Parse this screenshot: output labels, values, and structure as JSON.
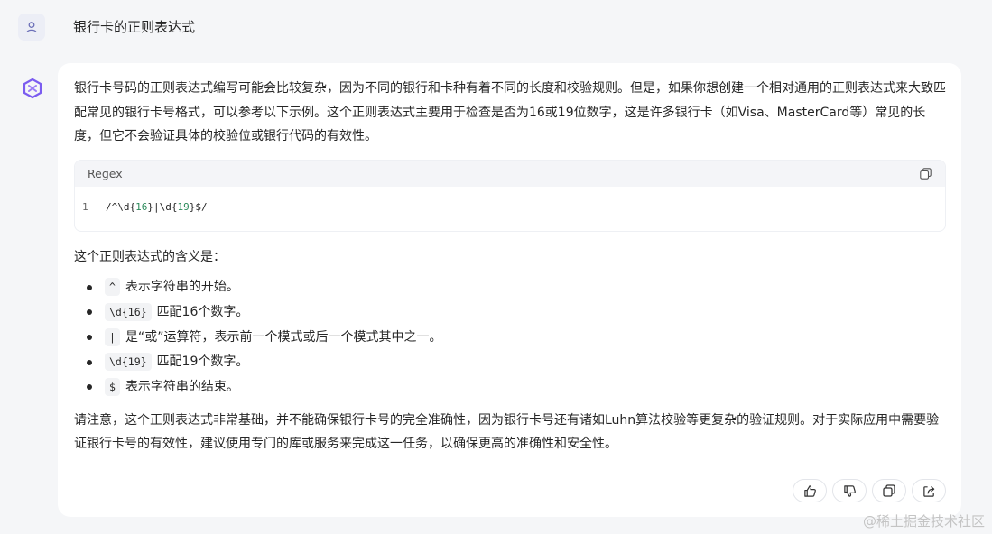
{
  "user": {
    "message": "银行卡的正则表达式"
  },
  "answer": {
    "intro": "银行卡号码的正则表达式编写可能会比较复杂，因为不同的银行和卡种有着不同的长度和校验规则。但是，如果你想创建一个相对通用的正则表达式来大致匹配常见的银行卡号格式，可以参考以下示例。这个正则表达式主要用于检查是否为16或19位数字，这是许多银行卡（如Visa、MasterCard等）常见的长度，但它不会验证具体的校验位或银行代码的有效性。",
    "code": {
      "language": "Regex",
      "line_number": "1",
      "parts": [
        "/^\\d{",
        "16",
        "}|\\d{",
        "19",
        "}$/"
      ]
    },
    "meaning_heading": "这个正则表达式的含义是：",
    "bullets": [
      {
        "token": "^",
        "text": "表示字符串的开始。"
      },
      {
        "token": "\\d{16}",
        "text": "匹配16个数字。"
      },
      {
        "token": "|",
        "text": "是“或”运算符，表示前一个模式或后一个模式其中之一。"
      },
      {
        "token": "\\d{19}",
        "text": "匹配19个数字。"
      },
      {
        "token": "$",
        "text": "表示字符串的结束。"
      }
    ],
    "note": "请注意，这个正则表达式非常基础，并不能确保银行卡号的完全准确性，因为银行卡号还有诸如Luhn算法校验等更复杂的验证规则。对于实际应用中需要验证银行卡号的有效性，建议使用专门的库或服务来完成这一任务，以确保更高的准确性和安全性。",
    "actions": [
      "thumbs-up-icon",
      "thumbs-down-icon",
      "copy-icon",
      "share-icon"
    ]
  },
  "watermark": "@稀土掘金技术社区",
  "colors": {
    "page_bg": "#f5f6f8",
    "card_bg": "#ffffff",
    "bot_avatar": "#7b5cf0",
    "code_number": "#2a8a5a"
  }
}
